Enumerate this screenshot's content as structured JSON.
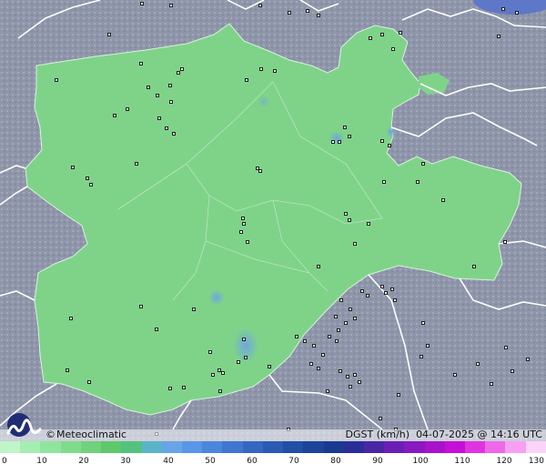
{
  "footer": {
    "credit": "Meteoclimatic",
    "copyright_symbol": "©",
    "variable": "DGST (km/h)",
    "timestamp": "04-07-2025 @ 14:16 UTC",
    "logo_icon": "meteoclimatic-m-logo-icon"
  },
  "legend": {
    "ticks": [
      "0",
      "10",
      "20",
      "30",
      "40",
      "50",
      "60",
      "70",
      "80",
      "90",
      "100",
      "110",
      "120",
      "130"
    ],
    "colors": [
      "#bff5c8",
      "#a4eeb1",
      "#90e59e",
      "#80dc8c",
      "#71d17c",
      "#5fc86b",
      "#53c27d",
      "#5ab4c9",
      "#68a4e6",
      "#5896e8",
      "#4a86dc",
      "#3f76cf",
      "#3567c1",
      "#2a5ab4",
      "#214fa5",
      "#1c449b",
      "#1a3a90",
      "#2a2f98",
      "#4a26a5",
      "#6a1fb3",
      "#8a18c0",
      "#a812cb",
      "#c60fd6",
      "#df33e0",
      "#ee68ea",
      "#f7a0f2",
      "#fcd4f9"
    ]
  },
  "map": {
    "background_color": "#8f96aa",
    "region_color": "#7fd389",
    "gust_hotspot_color": "#6ea4e2",
    "border_color": "#ffffff",
    "station_marker_color": "#111111"
  }
}
